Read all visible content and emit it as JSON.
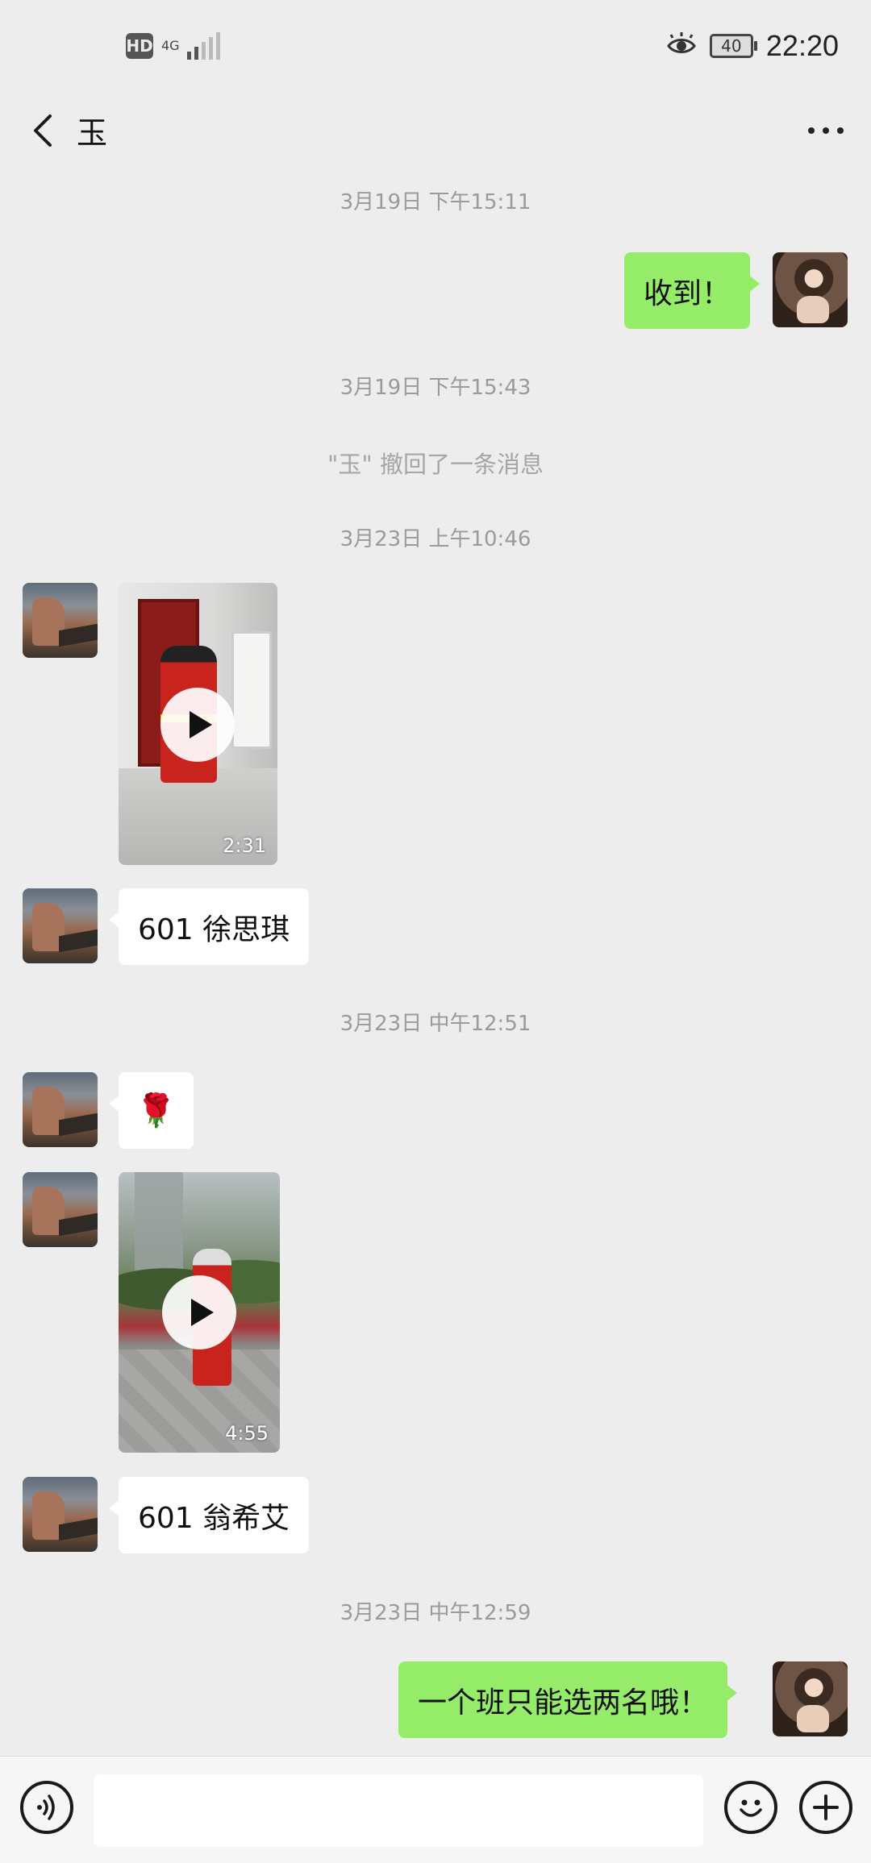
{
  "status_bar": {
    "hd_badge": "HD",
    "network": "4G",
    "battery": "40",
    "time": "22:20"
  },
  "header": {
    "title": "玉",
    "back_icon": "chevron-left-icon",
    "more_icon": "more-dots-icon"
  },
  "messages": {
    "ts1": "3月19日 下午15:11",
    "me1": "收到！",
    "ts2": "3月19日 下午15:43",
    "recall": "\"玉\" 撤回了一条消息",
    "ts3": "3月23日 上午10:46",
    "video1_duration": "2:31",
    "other1": "601 徐思琪",
    "ts4": "3月23日 中午12:51",
    "flower": "🌹",
    "video2_duration": "4:55",
    "other2": "601 翁希艾",
    "ts5": "3月23日 中午12:59",
    "me2": "一个班只能选两名哦！"
  },
  "bottom_bar": {
    "voice_icon": "voice-icon",
    "input_value": "",
    "emoji_icon": "emoji-icon",
    "plus_icon": "plus-icon"
  },
  "colors": {
    "background": "#ededed",
    "my_bubble": "#95ec69",
    "other_bubble": "#ffffff",
    "timestamp_text": "#9a9a9a"
  }
}
